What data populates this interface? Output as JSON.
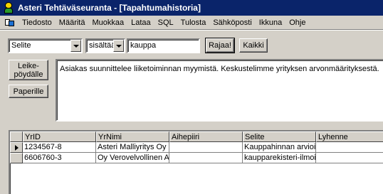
{
  "window": {
    "title": "Asteri Tehtäväseuranta - [Tapahtumahistoria]"
  },
  "menu": [
    "Tiedosto",
    "Määritä",
    "Muokkaa",
    "Lataa",
    "SQL",
    "Tulosta",
    "Sähköposti",
    "Ikkuna",
    "Ohje"
  ],
  "filter": {
    "field": "Selite",
    "operator": "sisältää",
    "value": "kauppa",
    "apply_label": "Rajaa!",
    "all_label": "Kaikki"
  },
  "side_buttons": {
    "clipboard_label": "Leike-\npöydälle",
    "paper_label": "Paperille"
  },
  "memo_text": "Asiakas suunnittelee liiketoiminnan myymistä. Keskustelimme yrityksen arvonmäärityksestä.",
  "table": {
    "columns": [
      "YrID",
      "YrNimi",
      "Aihepiiri",
      "Selite",
      "Lyhenne"
    ],
    "rows": [
      [
        "1234567-8",
        "Asteri Malliyritys Oy",
        "",
        "Kauppahinnan arvioi",
        ""
      ],
      [
        "6606760-3",
        "Oy Verovelvollinen A",
        "",
        "kaupparekisteri-ilmoit",
        ""
      ]
    ],
    "current_row": 0
  }
}
